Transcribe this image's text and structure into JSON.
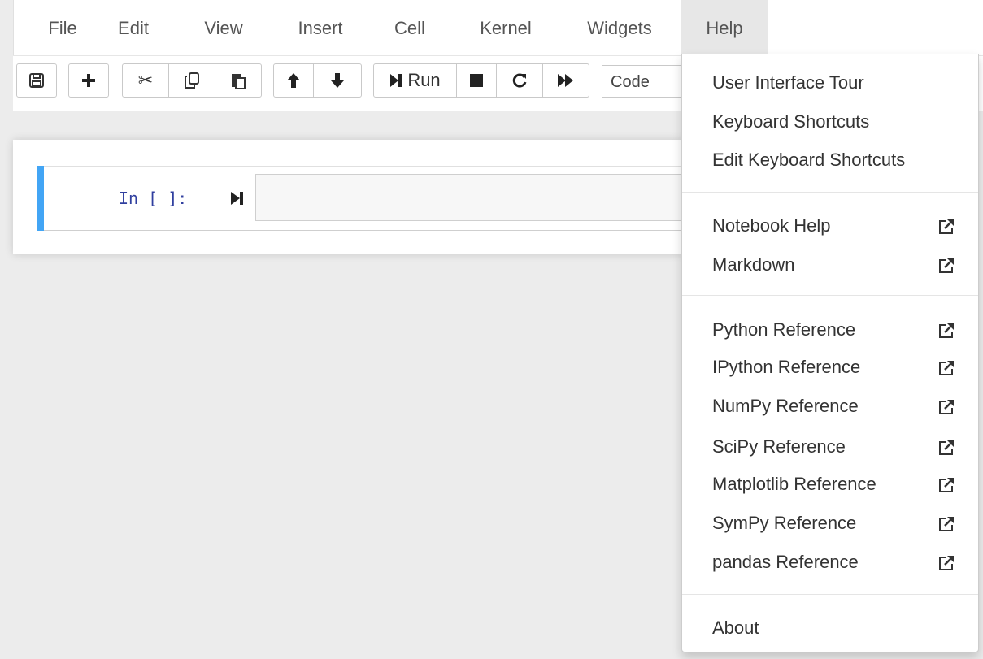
{
  "menubar": {
    "items": [
      "File",
      "Edit",
      "View",
      "Insert",
      "Cell",
      "Kernel",
      "Widgets",
      "Help"
    ],
    "active": "Help"
  },
  "toolbar": {
    "run_label": "Run",
    "cell_type_value": "Code",
    "icons": [
      "save-icon",
      "plus-icon",
      "cut-icon",
      "copy-icon",
      "paste-icon",
      "arrow-up-icon",
      "arrow-down-icon",
      "step-forward-icon",
      "stop-icon",
      "restart-icon",
      "fast-forward-icon"
    ]
  },
  "cell": {
    "prompt": "In [ ]:",
    "input_value": ""
  },
  "help_menu": {
    "group1": [
      "User Interface Tour",
      "Keyboard Shortcuts",
      "Edit Keyboard Shortcuts"
    ],
    "group2": [
      "Notebook Help",
      "Markdown"
    ],
    "group3": [
      "Python Reference",
      "IPython Reference",
      "NumPy Reference",
      "SciPy Reference",
      "Matplotlib Reference",
      "SymPy Reference",
      "pandas Reference"
    ],
    "group4": [
      "About"
    ]
  },
  "colors": {
    "accent": "#42a5f5",
    "prompt": "#303f9f",
    "background": "#ececec"
  }
}
